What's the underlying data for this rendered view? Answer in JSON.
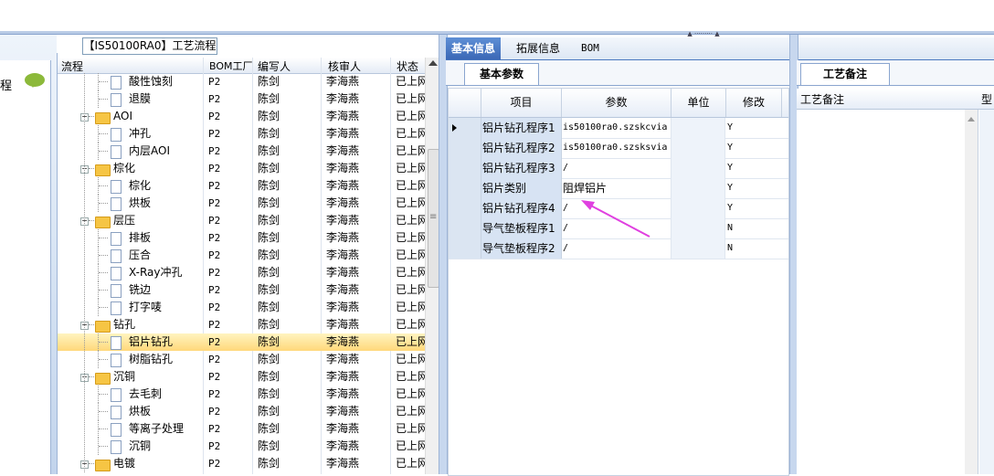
{
  "window": {
    "grip": "▲ ········· ▲"
  },
  "left_panel": {
    "char": "程"
  },
  "tree": {
    "title": "【IS50100RA0】工艺流程",
    "columns": [
      "流程",
      "BOM工厂",
      "编写人",
      "核审人",
      "状态"
    ],
    "rows": [
      {
        "level": 2,
        "type": "file",
        "name": "酸性蚀刻",
        "plant": "P2",
        "author": "陈剑",
        "reviewer": "李海燕",
        "status": "已上网"
      },
      {
        "level": 2,
        "type": "file",
        "name": "退膜",
        "plant": "P2",
        "author": "陈剑",
        "reviewer": "李海燕",
        "status": "已上网"
      },
      {
        "level": 1,
        "type": "folder",
        "name": "AOI",
        "plant": "P2",
        "author": "陈剑",
        "reviewer": "李海燕",
        "status": "已上网"
      },
      {
        "level": 2,
        "type": "file",
        "name": "冲孔",
        "plant": "P2",
        "author": "陈剑",
        "reviewer": "李海燕",
        "status": "已上网"
      },
      {
        "level": 2,
        "type": "file",
        "name": "内层AOI",
        "plant": "P2",
        "author": "陈剑",
        "reviewer": "李海燕",
        "status": "已上网"
      },
      {
        "level": 1,
        "type": "folder",
        "name": "棕化",
        "plant": "P2",
        "author": "陈剑",
        "reviewer": "李海燕",
        "status": "已上网"
      },
      {
        "level": 2,
        "type": "file",
        "name": "棕化",
        "plant": "P2",
        "author": "陈剑",
        "reviewer": "李海燕",
        "status": "已上网"
      },
      {
        "level": 2,
        "type": "file",
        "name": "烘板",
        "plant": "P2",
        "author": "陈剑",
        "reviewer": "李海燕",
        "status": "已上网"
      },
      {
        "level": 1,
        "type": "folder",
        "name": "层压",
        "plant": "P2",
        "author": "陈剑",
        "reviewer": "李海燕",
        "status": "已上网"
      },
      {
        "level": 2,
        "type": "file",
        "name": "排板",
        "plant": "P2",
        "author": "陈剑",
        "reviewer": "李海燕",
        "status": "已上网"
      },
      {
        "level": 2,
        "type": "file",
        "name": "压合",
        "plant": "P2",
        "author": "陈剑",
        "reviewer": "李海燕",
        "status": "已上网"
      },
      {
        "level": 2,
        "type": "file",
        "name": "X-Ray冲孔",
        "plant": "P2",
        "author": "陈剑",
        "reviewer": "李海燕",
        "status": "已上网"
      },
      {
        "level": 2,
        "type": "file",
        "name": "铣边",
        "plant": "P2",
        "author": "陈剑",
        "reviewer": "李海燕",
        "status": "已上网"
      },
      {
        "level": 2,
        "type": "file",
        "name": "打字唛",
        "plant": "P2",
        "author": "陈剑",
        "reviewer": "李海燕",
        "status": "已上网"
      },
      {
        "level": 1,
        "type": "folder",
        "name": "钻孔",
        "plant": "P2",
        "author": "陈剑",
        "reviewer": "李海燕",
        "status": "已上网"
      },
      {
        "level": 2,
        "type": "file",
        "name": "铝片钻孔",
        "plant": "P2",
        "author": "陈剑",
        "reviewer": "李海燕",
        "status": "已上网",
        "selected": true
      },
      {
        "level": 2,
        "type": "file",
        "name": "树脂钻孔",
        "plant": "P2",
        "author": "陈剑",
        "reviewer": "李海燕",
        "status": "已上网"
      },
      {
        "level": 1,
        "type": "folder",
        "name": "沉铜",
        "plant": "P2",
        "author": "陈剑",
        "reviewer": "李海燕",
        "status": "已上网"
      },
      {
        "level": 2,
        "type": "file",
        "name": "去毛刺",
        "plant": "P2",
        "author": "陈剑",
        "reviewer": "李海燕",
        "status": "已上网"
      },
      {
        "level": 2,
        "type": "file",
        "name": "烘板",
        "plant": "P2",
        "author": "陈剑",
        "reviewer": "李海燕",
        "status": "已上网"
      },
      {
        "level": 2,
        "type": "file",
        "name": "等离子处理",
        "plant": "P2",
        "author": "陈剑",
        "reviewer": "李海燕",
        "status": "已上网"
      },
      {
        "level": 2,
        "type": "file",
        "name": "沉铜",
        "plant": "P2",
        "author": "陈剑",
        "reviewer": "李海燕",
        "status": "已上网"
      },
      {
        "level": 1,
        "type": "folder",
        "name": "电镀",
        "plant": "P2",
        "author": "陈剑",
        "reviewer": "李海燕",
        "status": "已上网"
      }
    ]
  },
  "main_tabs": [
    "基本信息",
    "拓展信息",
    "BOM"
  ],
  "basic": {
    "tab": "基本参数",
    "columns": [
      "项目",
      "参数",
      "单位",
      "修改"
    ],
    "rows": [
      {
        "item": "铝片钻孔程序1",
        "param": "is50100ra0.szskcvia",
        "unit": "",
        "modify": "Y",
        "current": true
      },
      {
        "item": "铝片钻孔程序2",
        "param": "is50100ra0.szsksvia",
        "unit": "",
        "modify": "Y"
      },
      {
        "item": "铝片钻孔程序3",
        "param": "/",
        "unit": "",
        "modify": "Y"
      },
      {
        "item": "铝片类别",
        "param": "阻焊铝片",
        "unit": "",
        "modify": "Y"
      },
      {
        "item": "铝片钻孔程序4",
        "param": "/",
        "unit": "",
        "modify": "Y"
      },
      {
        "item": "导气垫板程序1",
        "param": "/",
        "unit": "",
        "modify": "N"
      },
      {
        "item": "导气垫板程序2",
        "param": "/",
        "unit": "",
        "modify": "N"
      }
    ]
  },
  "remarks": {
    "tab": "工艺备注",
    "column": "工艺备注",
    "extra_column": "型"
  },
  "annotation": {
    "color": "#e040e0"
  }
}
